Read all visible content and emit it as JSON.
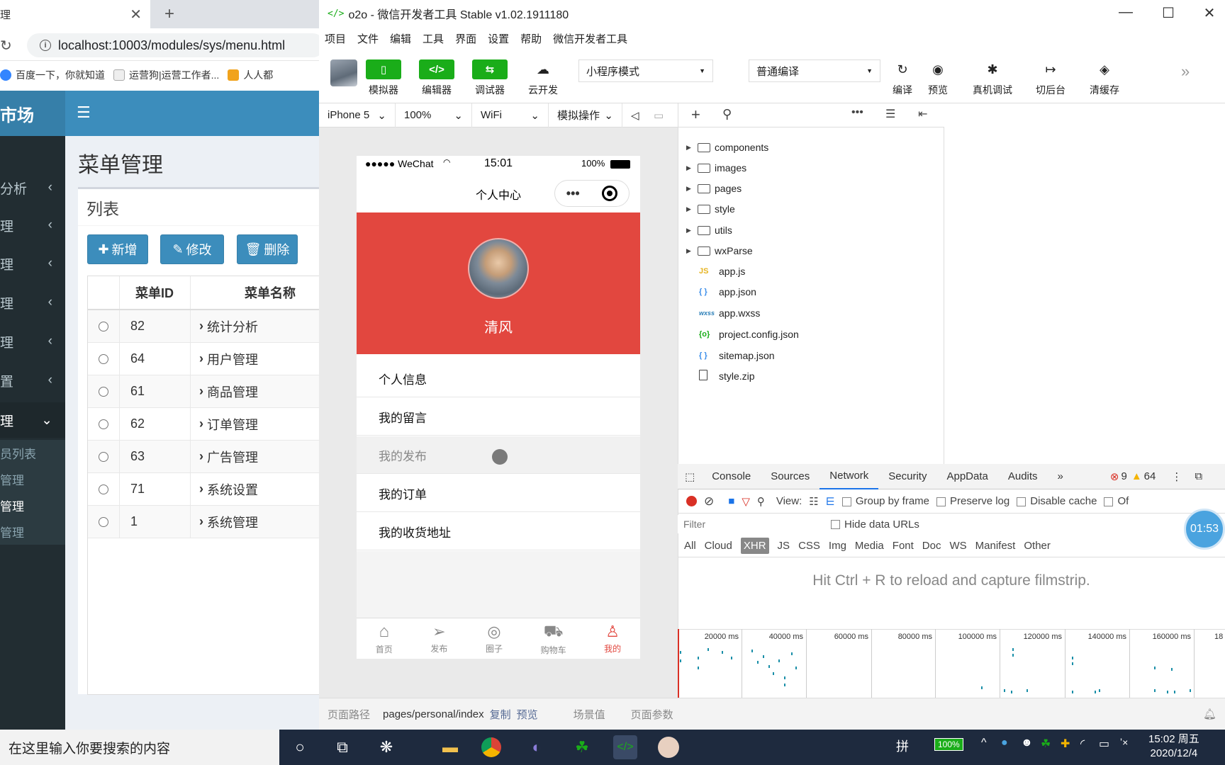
{
  "browser": {
    "tab_title": "理",
    "url": "localhost:10003/modules/sys/menu.html",
    "bookmarks": [
      "百度一下，你就知道",
      "运营狗|运营工作者...",
      "人人都"
    ]
  },
  "app": {
    "logo": "市场",
    "page_title": "菜单管理",
    "box_title": "列表",
    "sidebar": [
      "分析",
      "理",
      "理",
      "理",
      "理",
      "置",
      "理"
    ],
    "sidebar_sub": [
      "员列表",
      "管理",
      "管理",
      "管理"
    ],
    "buttons": {
      "add": "新增",
      "edit": "修改",
      "delete": "删除"
    },
    "table": {
      "headers": [
        "菜单ID",
        "菜单名称"
      ],
      "rows": [
        {
          "id": "82",
          "name": "统计分析"
        },
        {
          "id": "64",
          "name": "用户管理"
        },
        {
          "id": "61",
          "name": "商品管理"
        },
        {
          "id": "62",
          "name": "订单管理"
        },
        {
          "id": "63",
          "name": "广告管理"
        },
        {
          "id": "71",
          "name": "系统设置"
        },
        {
          "id": "1",
          "name": "系统管理"
        }
      ]
    }
  },
  "devtools": {
    "title": "o2o - 微信开发者工具 Stable v1.02.1911180",
    "menu": [
      "项目",
      "文件",
      "编辑",
      "工具",
      "界面",
      "设置",
      "帮助",
      "微信开发者工具"
    ],
    "tools": {
      "simulator": "模拟器",
      "editor": "编辑器",
      "debugger": "调试器",
      "cloud": "云开发",
      "compile": "编译",
      "preview": "预览",
      "remote_debug": "真机调试",
      "background": "切后台",
      "clear_cache": "清缓存"
    },
    "mode_select": "小程序模式",
    "compile_select": "普通编译",
    "sim_bar": {
      "device": "iPhone 5",
      "zoom": "100%",
      "network": "WiFi",
      "operation": "模拟操作"
    },
    "bottom": {
      "path_label": "页面路径",
      "path": "pages/personal/index",
      "copy": "复制",
      "preview": "预览",
      "scene": "场景值",
      "params": "页面参数"
    }
  },
  "phone": {
    "carrier": "●●●●● WeChat",
    "time": "15:01",
    "battery": "100%",
    "nav_title": "个人中心",
    "user_name": "清风",
    "menu": [
      "个人信息",
      "我的留言",
      "我的发布",
      "我的订单",
      "我的收货地址"
    ],
    "tabs": [
      "首页",
      "发布",
      "圈子",
      "购物车",
      "我的"
    ]
  },
  "filetree": {
    "folders": [
      "components",
      "images",
      "pages",
      "style",
      "utils",
      "wxParse"
    ],
    "files": [
      {
        "type": "JS",
        "name": "app.js",
        "color": "#e6b422"
      },
      {
        "type": "{ }",
        "name": "app.json",
        "color": "#3b8eea"
      },
      {
        "type": "wxss",
        "name": "app.wxss",
        "color": "#2c7fb8"
      },
      {
        "type": "{o}",
        "name": "project.config.json",
        "color": "#1aad19"
      },
      {
        "type": "{ }",
        "name": "sitemap.json",
        "color": "#3b8eea"
      },
      {
        "type": "",
        "name": "style.zip",
        "color": "#555"
      }
    ]
  },
  "network": {
    "tabs": [
      "Console",
      "Sources",
      "Network",
      "Security",
      "AppData",
      "Audits"
    ],
    "errors": "9",
    "warnings": "64",
    "view_label": "View:",
    "group_by_frame": "Group by frame",
    "preserve_log": "Preserve log",
    "disable_cache": "Disable cache",
    "offline": "Of",
    "filter_placeholder": "Filter",
    "hide_data_urls": "Hide data URLs",
    "types": [
      "All",
      "Cloud",
      "XHR",
      "JS",
      "CSS",
      "Img",
      "Media",
      "Font",
      "Doc",
      "WS",
      "Manifest",
      "Other"
    ],
    "hint": "Hit Ctrl + R to reload and capture filmstrip.",
    "ticks": [
      "20000 ms",
      "40000 ms",
      "60000 ms",
      "80000 ms",
      "100000 ms",
      "120000 ms",
      "140000 ms",
      "160000 ms",
      "18"
    ],
    "timer": "01:53"
  },
  "taskbar": {
    "search": "在这里输入你要搜索的内容",
    "ime": "拼",
    "battery": "100%",
    "time": "15:02 周五",
    "date": "2020/12/4",
    "mute": "ʼ×"
  },
  "colors": {
    "app_blue": "#3c8dbc",
    "wx_green": "#1aad19",
    "phone_red": "#e2473f"
  }
}
